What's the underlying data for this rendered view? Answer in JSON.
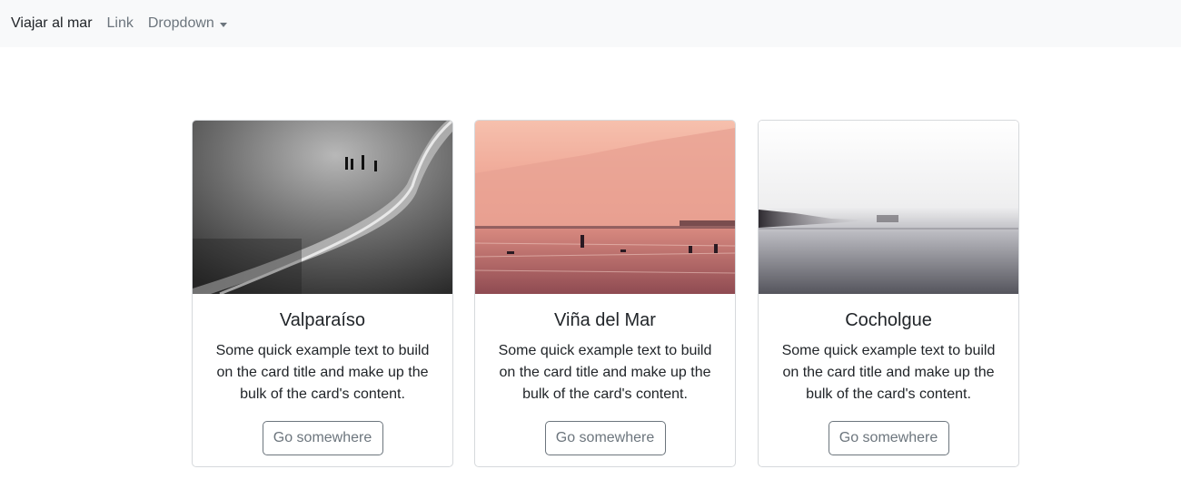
{
  "navbar": {
    "brand": "Viajar al mar",
    "link": "Link",
    "dropdown": "Dropdown"
  },
  "cards": [
    {
      "title": "Valparaíso",
      "text": "Some quick example text to build on the card title and make up the bulk of the card's content.",
      "button": "Go somewhere"
    },
    {
      "title": "Viña del Mar",
      "text": "Some quick example text to build on the card title and make up the bulk of the card's content.",
      "button": "Go somewhere"
    },
    {
      "title": "Cocholgue",
      "text": "Some quick example text to build on the card title and make up the bulk of the card's content.",
      "button": "Go somewhere"
    }
  ],
  "colors": {
    "navbar_bg": "#f8f9fa",
    "button_border": "#6c757d",
    "card_border": "#d6d9dc"
  }
}
